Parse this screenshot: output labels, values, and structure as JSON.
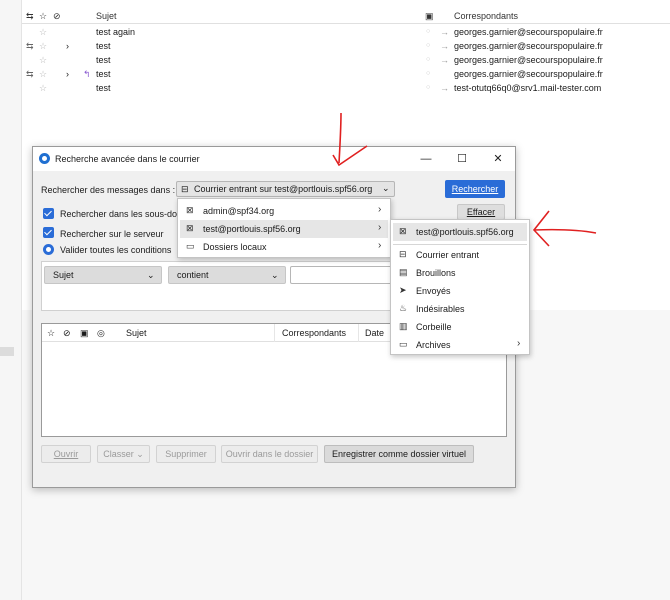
{
  "message_list": {
    "header": {
      "subject": "Sujet",
      "correspondents": "Correspondants"
    },
    "rows": [
      {
        "subject": "test again",
        "correspondent": "georges.garnier@secourspopulaire.fr"
      },
      {
        "subject": "test",
        "correspondent": "georges.garnier@secourspopulaire.fr"
      },
      {
        "subject": "test",
        "correspondent": "georges.garnier@secourspopulaire.fr"
      },
      {
        "subject": "test",
        "correspondent": "georges.garnier@secourspopulaire.fr"
      },
      {
        "subject": "test",
        "correspondent": "test-otutq66q0@srv1.mail-tester.com"
      }
    ]
  },
  "dialog": {
    "title": "Recherche avancée dans le courrier",
    "search_in_label": "Rechercher des messages dans :",
    "folder_selected": "Courrier entrant sur test@portlouis.spf56.org",
    "search_button": "Rechercher",
    "clear_button": "Effacer",
    "subfolders_label": "Rechercher dans les sous-dos",
    "server_label": "Rechercher sur le serveur",
    "match_all_label": "Valider toutes les conditions",
    "criteria": {
      "field": "Sujet",
      "operator": "contient",
      "value": ""
    },
    "results_columns": [
      "Sujet",
      "Correspondants",
      "Date"
    ],
    "footer_buttons": [
      "Ouvrir",
      "Classer",
      "Supprimer",
      "Ouvrir dans le dossier",
      "Enregistrer comme dossier virtuel"
    ]
  },
  "account_menu": {
    "items": [
      "admin@spf34.org",
      "test@portlouis.spf56.org",
      "Dossiers locaux"
    ]
  },
  "folder_menu": {
    "account": "test@portlouis.spf56.org",
    "items": [
      "Courrier entrant",
      "Brouillons",
      "Envoyés",
      "Indésirables",
      "Corbeille",
      "Archives"
    ]
  },
  "colors": {
    "accent": "#2a6cd7",
    "annotation": "#e02020"
  }
}
